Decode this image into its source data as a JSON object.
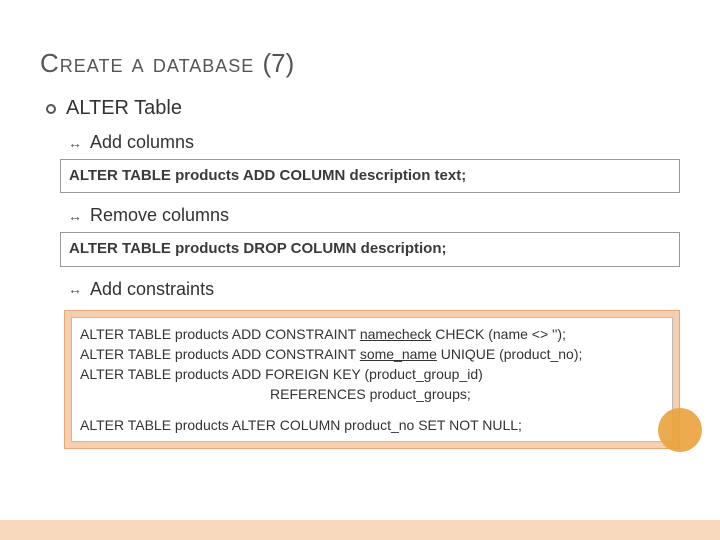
{
  "title": {
    "main": "Create a database",
    "num": "(7)"
  },
  "bullet": {
    "label": "ALTER Table"
  },
  "sub": {
    "add_cols": "Add columns",
    "remove_cols": "Remove columns",
    "add_constraints": "Add constraints"
  },
  "code": {
    "add_col": "ALTER TABLE products ADD COLUMN description text;",
    "drop_col": "ALTER TABLE products DROP COLUMN description;"
  },
  "constraints": {
    "line1_a": "ALTER TABLE products ADD CONSTRAINT ",
    "line1_u": "namecheck",
    "line1_b": " CHECK (name <> '');",
    "line2_a": "ALTER TABLE products ADD CONSTRAINT ",
    "line2_u": "some_name",
    "line2_b": " UNIQUE (product_no);",
    "line3": "ALTER TABLE products ADD FOREIGN KEY (product_group_id)",
    "line3_indent": "REFERENCES product_groups;",
    "line4": "ALTER TABLE products ALTER COLUMN product_no SET NOT NULL;"
  }
}
